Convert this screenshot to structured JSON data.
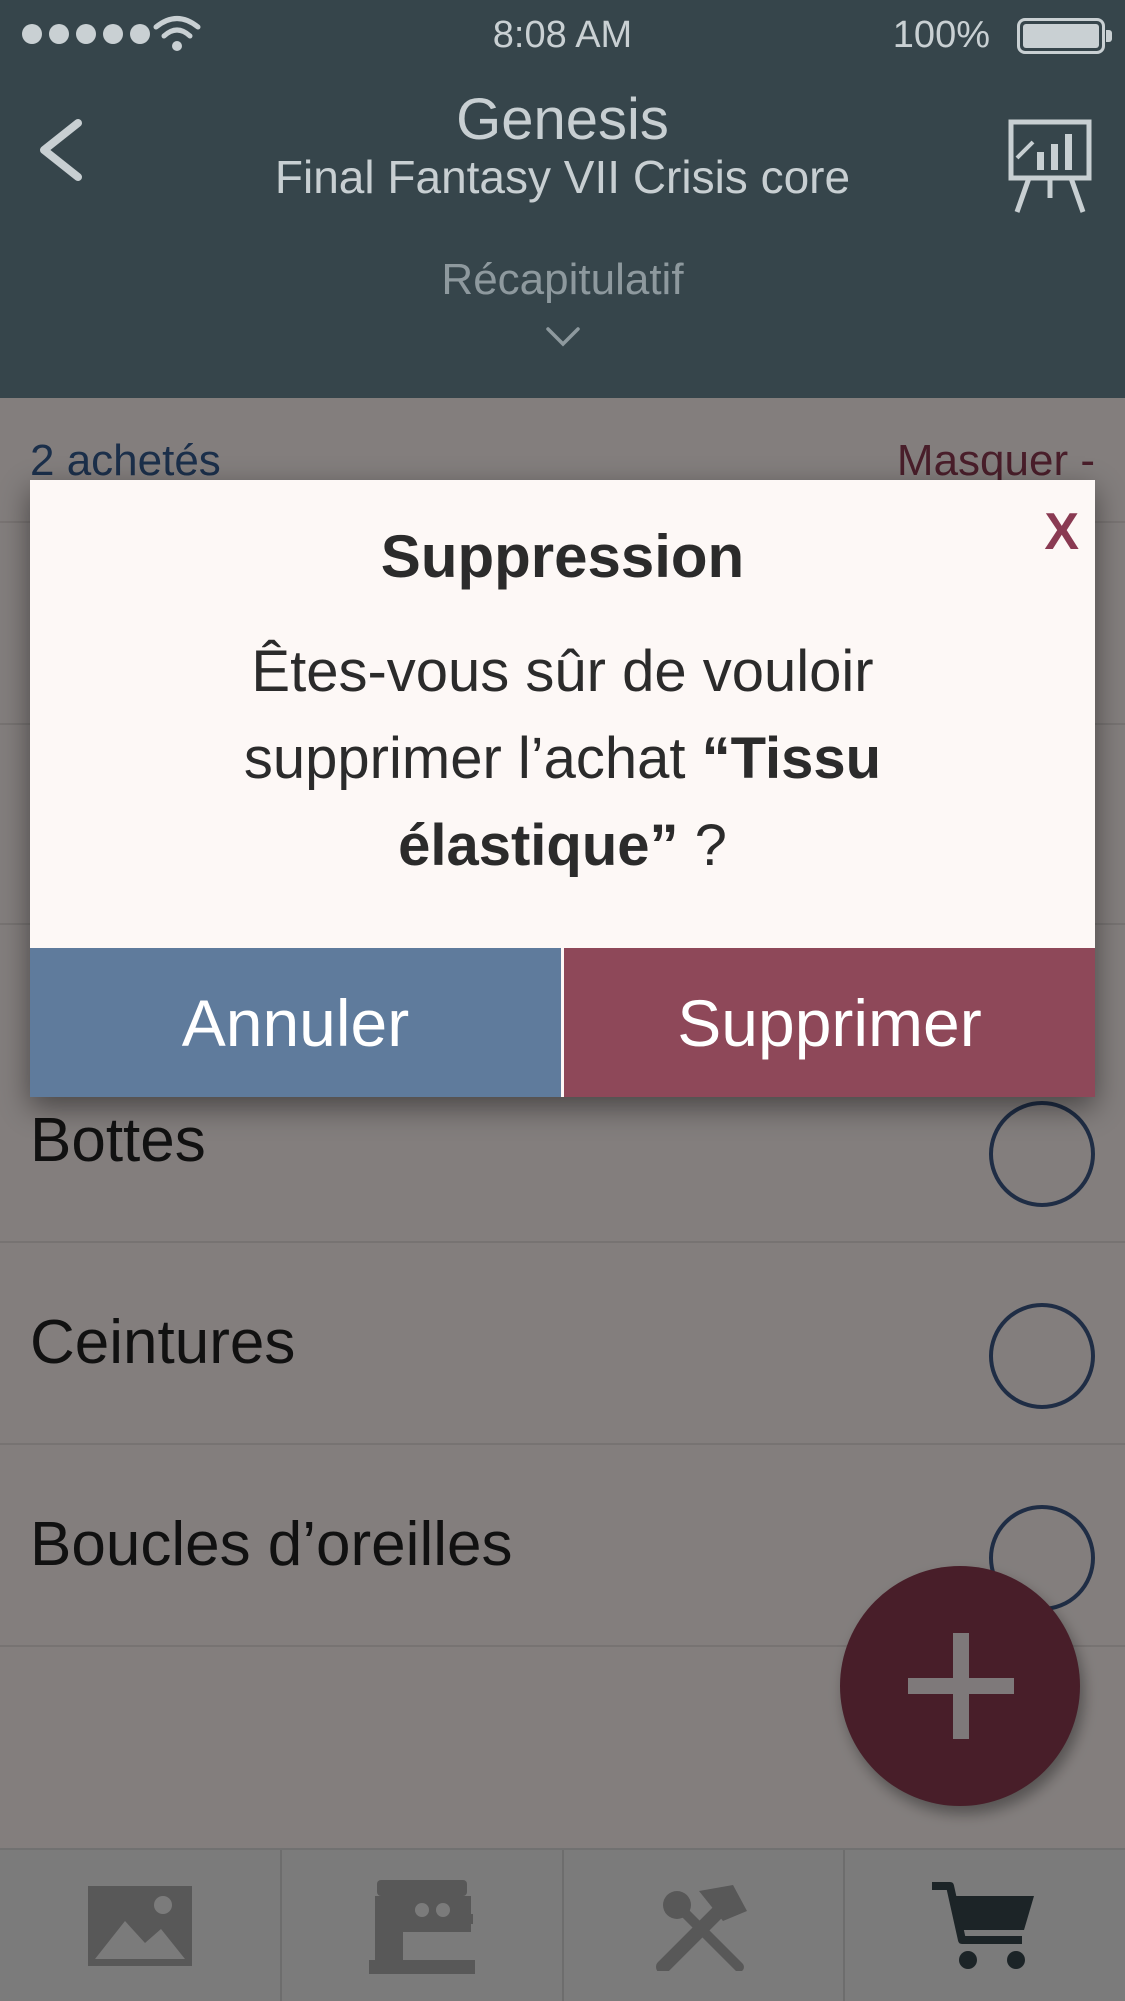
{
  "status_bar": {
    "time": "8:08 AM",
    "battery": "100%"
  },
  "header": {
    "title": "Genesis",
    "subtitle": "Final Fantasy VII Crisis core",
    "section": "Récapitulatif"
  },
  "list": {
    "bought_count": "2 achetés",
    "toggle_label": "Masquer -",
    "items": [
      {
        "label": "Bottes",
        "checked": false
      },
      {
        "label": "Ceintures",
        "checked": false
      },
      {
        "label": "Boucles d’oreilles",
        "checked": false
      }
    ]
  },
  "dialog": {
    "title": "Suppression",
    "close_label": "X",
    "message_prefix": "Êtes-vous sûr de vouloir supprimer l’achat ",
    "message_item": "“Tissu élastique”",
    "message_suffix": " ?",
    "cancel_label": "Annuler",
    "confirm_label": "Supprimer"
  },
  "tabs": [
    {
      "icon": "image-icon",
      "active": false
    },
    {
      "icon": "sewing-machine-icon",
      "active": false
    },
    {
      "icon": "tools-icon",
      "active": false
    },
    {
      "icon": "cart-icon",
      "active": true
    }
  ],
  "colors": {
    "header_bg": "#36454b",
    "accent_wine": "#8a3b4f",
    "accent_blue": "#355a8f",
    "cancel_button": "#5f7b9c",
    "delete_button": "#8e4859"
  }
}
